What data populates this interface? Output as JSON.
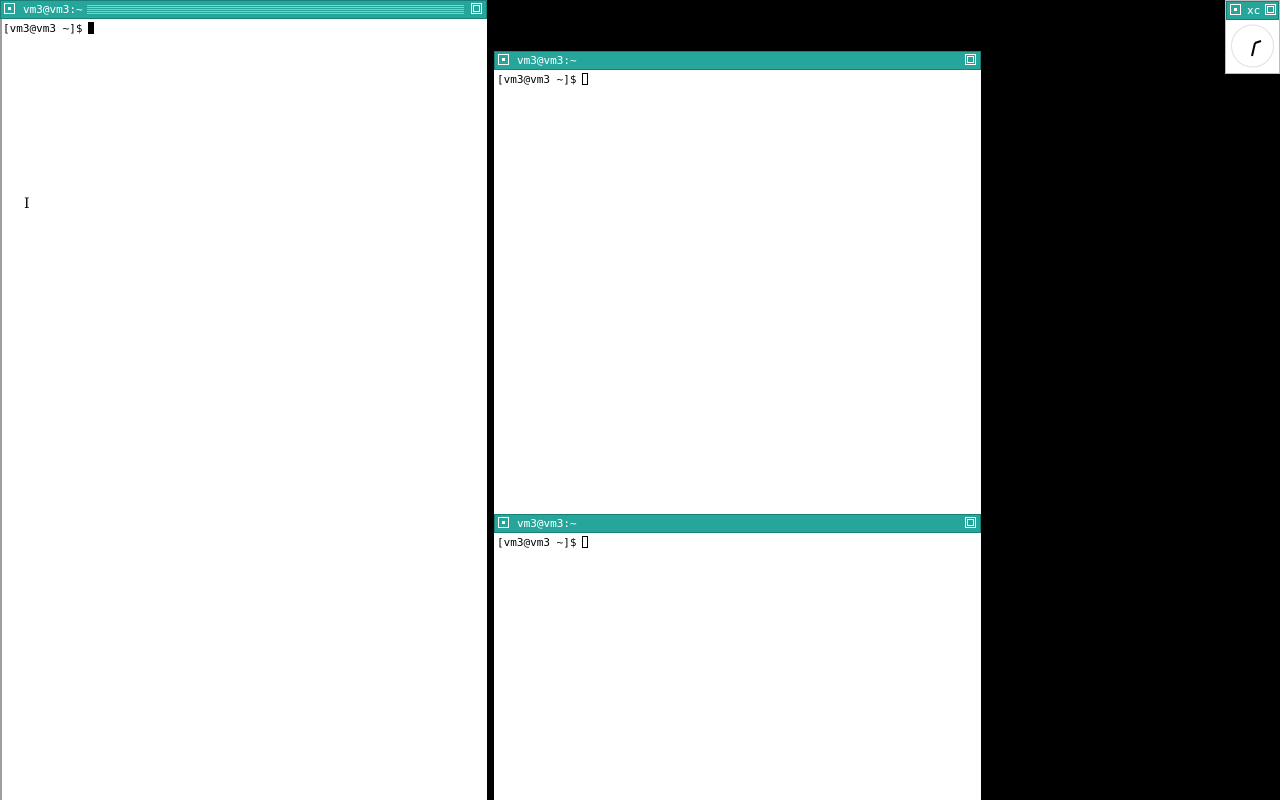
{
  "windows": [
    {
      "title": "vm3@vm3:~",
      "prompt": "[vm3@vm3 ~]$",
      "cursor": "solid",
      "focused": true
    },
    {
      "title": "vm3@vm3:~",
      "prompt": "[vm3@vm3 ~]$",
      "cursor": "hollow",
      "focused": false
    },
    {
      "title": "vm3@vm3:~",
      "prompt": "[vm3@vm3 ~]$",
      "cursor": "hollow",
      "focused": false
    }
  ],
  "clock": {
    "title": "xc"
  },
  "colors": {
    "titlebar": "#26a69a",
    "desktop": "#000000",
    "terminal_bg": "#ffffff"
  },
  "icons": {
    "window_menu": "window-menu-icon",
    "maximize": "maximize-icon",
    "mouse_pointer": "text-cursor-icon"
  }
}
